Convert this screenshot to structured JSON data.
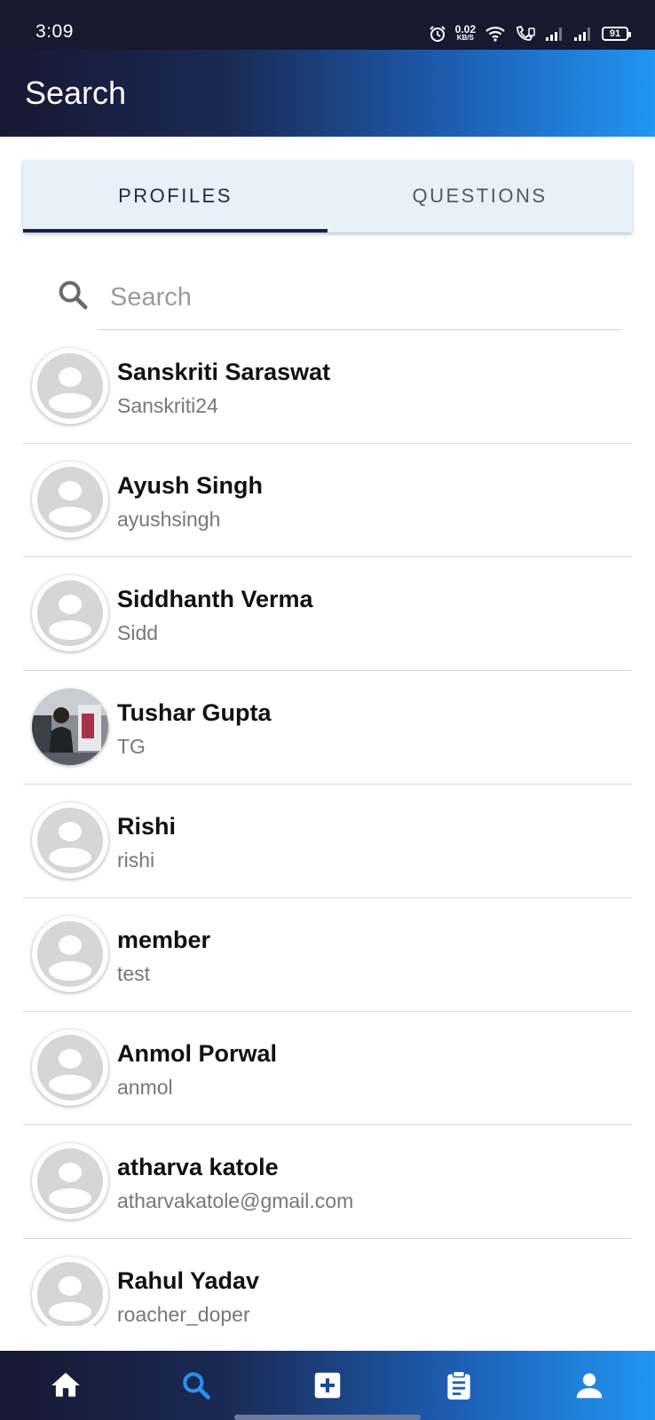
{
  "status_bar": {
    "time": "3:09",
    "net_speed_value": "0.02",
    "net_speed_unit": "KB/S",
    "battery": "91"
  },
  "app_bar": {
    "title": "Search"
  },
  "tabs": [
    {
      "label": "PROFILES",
      "active": true
    },
    {
      "label": "QUESTIONS",
      "active": false
    }
  ],
  "search": {
    "placeholder": "Search",
    "value": ""
  },
  "profiles": [
    {
      "name": "Sanskriti Saraswat",
      "handle": "Sanskriti24",
      "avatar": "default-avatar"
    },
    {
      "name": "Ayush Singh",
      "handle": "ayushsingh",
      "avatar": "default-avatar"
    },
    {
      "name": "Siddhanth Verma",
      "handle": "Sidd",
      "avatar": "default-avatar"
    },
    {
      "name": "Tushar Gupta",
      "handle": "TG",
      "avatar": "photo"
    },
    {
      "name": "Rishi",
      "handle": "rishi",
      "avatar": "default-avatar"
    },
    {
      "name": "member",
      "handle": "test",
      "avatar": "default-avatar"
    },
    {
      "name": "Anmol Porwal",
      "handle": "anmol",
      "avatar": "default-avatar"
    },
    {
      "name": "atharva katole",
      "handle": "atharvakatole@gmail.com",
      "avatar": "default-avatar"
    },
    {
      "name": "Rahul Yadav",
      "handle": "roacher_doper",
      "avatar": "default-avatar"
    }
  ],
  "bottom_nav": [
    {
      "name": "home",
      "icon": "home-icon",
      "active": false
    },
    {
      "name": "search",
      "icon": "search-icon",
      "active": true
    },
    {
      "name": "add",
      "icon": "add-box-icon",
      "active": false
    },
    {
      "name": "clipboard",
      "icon": "clipboard-icon",
      "active": false
    },
    {
      "name": "profile",
      "icon": "person-icon",
      "active": false
    }
  ],
  "colors": {
    "active_nav": "#2a8ff0",
    "inactive_nav": "#ffffff",
    "avatar_placeholder": "#d6d6d6"
  }
}
